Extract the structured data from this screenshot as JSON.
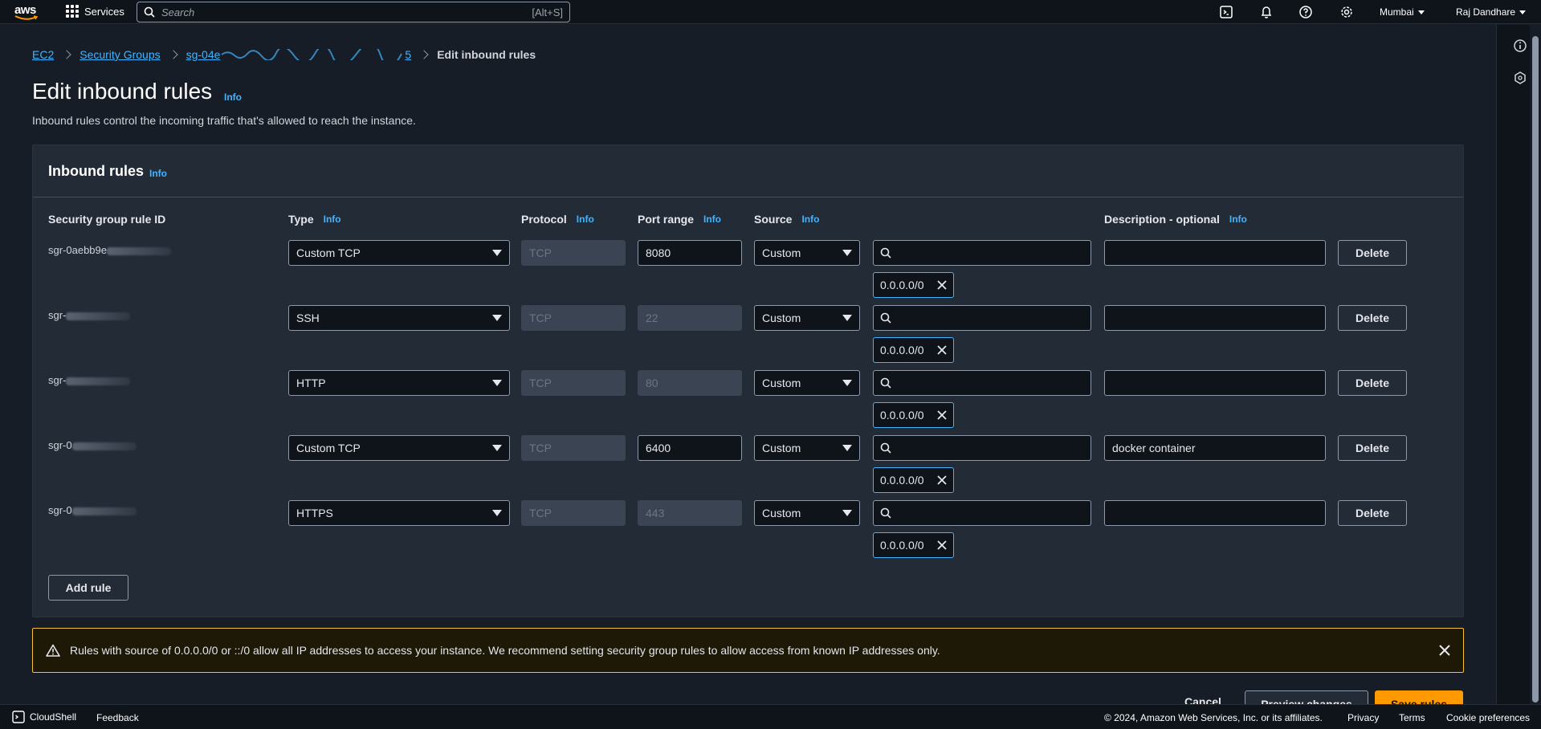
{
  "topnav": {
    "logo_text": "aws",
    "services_label": "Services",
    "search_placeholder": "Search",
    "search_shortcut": "[Alt+S]",
    "region": "Mumbai",
    "user": "Raj Dandhare"
  },
  "breadcrumb": {
    "ec2": "EC2",
    "security_groups": "Security Groups",
    "sg_id_prefix": "sg-04e",
    "sg_id_suffix": "5",
    "current": "Edit inbound rules"
  },
  "page": {
    "title": "Edit inbound rules",
    "info": "Info",
    "subtitle": "Inbound rules control the incoming traffic that's allowed to reach the instance."
  },
  "panel": {
    "title": "Inbound rules",
    "info": "Info",
    "headers": {
      "rule_id": "Security group rule ID",
      "type": "Type",
      "protocol": "Protocol",
      "port_range": "Port range",
      "source": "Source",
      "description": "Description - optional"
    },
    "rows": [
      {
        "rule_id": "sgr-0aebb9e",
        "type": "Custom TCP",
        "protocol": "TCP",
        "port": "8080",
        "port_disabled": false,
        "source": "Custom",
        "cidr": "0.0.0.0/0",
        "description": ""
      },
      {
        "rule_id": "sgr-",
        "type": "SSH",
        "protocol": "TCP",
        "port": "22",
        "port_disabled": true,
        "source": "Custom",
        "cidr": "0.0.0.0/0",
        "description": ""
      },
      {
        "rule_id": "sgr-",
        "type": "HTTP",
        "protocol": "TCP",
        "port": "80",
        "port_disabled": true,
        "source": "Custom",
        "cidr": "0.0.0.0/0",
        "description": ""
      },
      {
        "rule_id": "sgr-0",
        "type": "Custom TCP",
        "protocol": "TCP",
        "port": "6400",
        "port_disabled": false,
        "source": "Custom",
        "cidr": "0.0.0.0/0",
        "description": "docker container"
      },
      {
        "rule_id": "sgr-0",
        "type": "HTTPS",
        "protocol": "TCP",
        "port": "443",
        "port_disabled": true,
        "source": "Custom",
        "cidr": "0.0.0.0/0",
        "description": ""
      }
    ],
    "delete_label": "Delete",
    "add_rule_label": "Add rule"
  },
  "warning": {
    "text": "Rules with source of 0.0.0.0/0 or ::/0 allow all IP addresses to access your instance. We recommend setting security group rules to allow access from known IP addresses only."
  },
  "actions": {
    "cancel": "Cancel",
    "preview": "Preview changes",
    "save": "Save rules"
  },
  "footer": {
    "cloudshell": "CloudShell",
    "feedback": "Feedback",
    "copyright": "© 2024, Amazon Web Services, Inc. or its affiliates.",
    "privacy": "Privacy",
    "terms": "Terms",
    "cookie": "Cookie preferences"
  },
  "colors": {
    "accent_link": "#42b4ff",
    "primary_button": "#ff9900",
    "warning_border": "#f3c133",
    "background": "#161d26"
  }
}
